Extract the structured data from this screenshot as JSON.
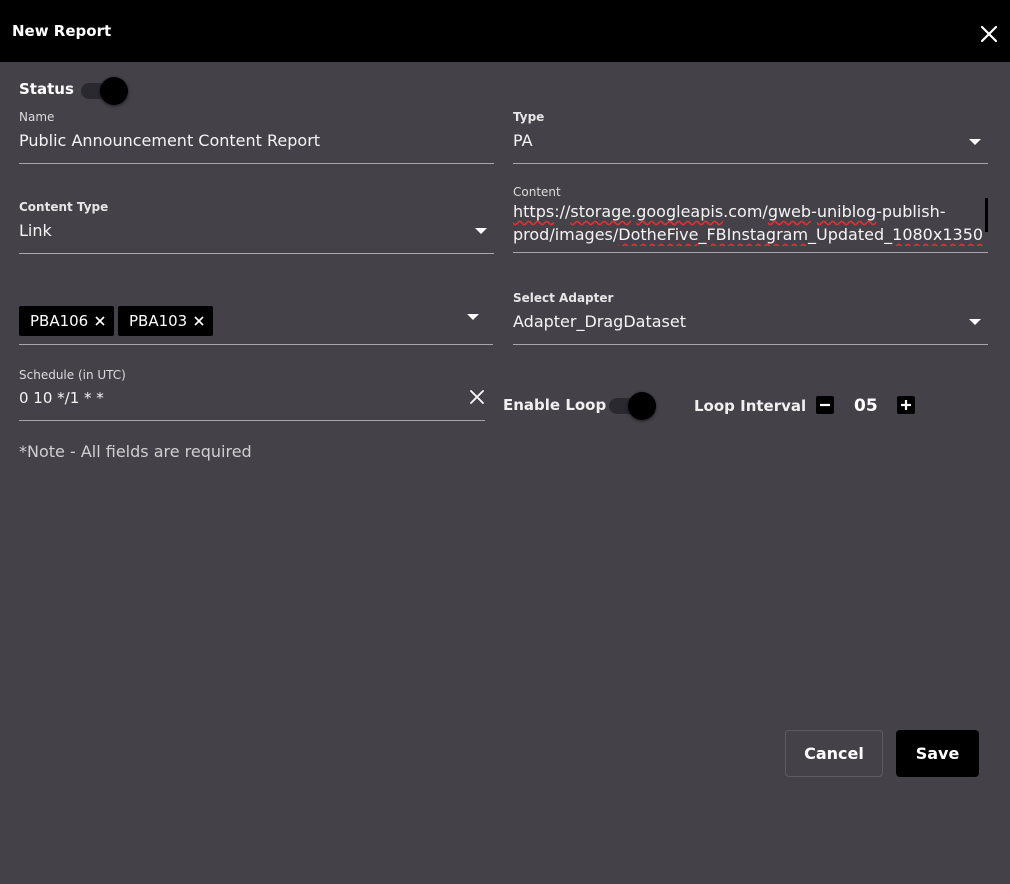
{
  "dialog": {
    "title": "New Report"
  },
  "status": {
    "label": "Status",
    "enabled": true
  },
  "name": {
    "label": "Name",
    "value": "Public Announcement Content Report"
  },
  "type": {
    "label": "Type",
    "value": "PA"
  },
  "content_type": {
    "label": "Content Type",
    "value": "Link"
  },
  "content": {
    "label": "Content",
    "line1_parts": [
      "https",
      "://",
      "storage",
      ".",
      "googleapis",
      ".com/",
      "gweb",
      "-",
      "uniblog",
      "-publish-"
    ],
    "line2_parts": [
      "prod/images/",
      "DotheFive",
      "_",
      "FBInstagram",
      "_Updated_",
      "1080x1350",
      ". "
    ]
  },
  "devices": {
    "chips": [
      "PBA106",
      "PBA103"
    ]
  },
  "adapter": {
    "label": "Select Adapter",
    "value": "Adapter_DragDataset"
  },
  "schedule": {
    "label": "Schedule (in UTC)",
    "value": "0 10 */1 * *"
  },
  "loop": {
    "enable_label": "Enable Loop",
    "enabled": true,
    "interval_label": "Loop Interval",
    "interval_value": "05"
  },
  "note": "*Note - All fields are required",
  "buttons": {
    "cancel": "Cancel",
    "save": "Save"
  },
  "colors": {
    "background": "#444149",
    "titlebar": "#000000",
    "accent": "#000000",
    "spellcheck": "#dd3333"
  }
}
